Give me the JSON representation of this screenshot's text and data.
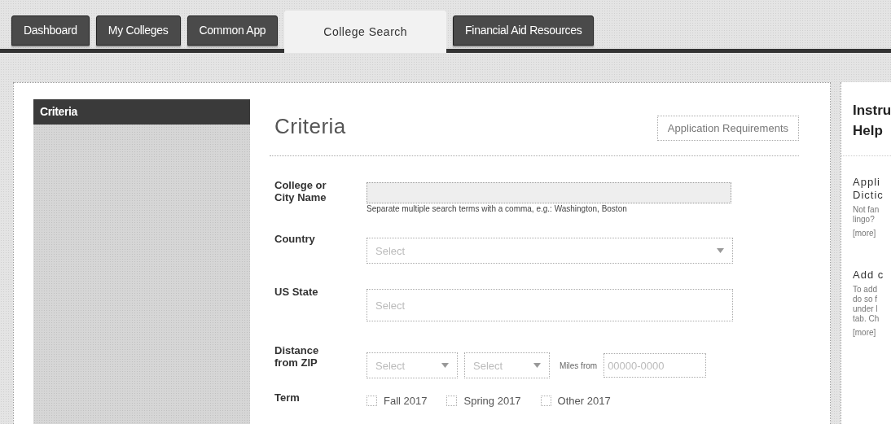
{
  "tabs": [
    {
      "label": "Dashboard",
      "selected": false
    },
    {
      "label": "My Colleges",
      "selected": false
    },
    {
      "label": "Common App",
      "selected": false
    },
    {
      "label": "College Search",
      "selected": true
    },
    {
      "label": "Financial Aid Resources",
      "selected": false
    }
  ],
  "sidebar": {
    "items": [
      {
        "label": "Criteria",
        "selected": true
      }
    ]
  },
  "form": {
    "title": "Criteria",
    "action": "Application Requirements",
    "fields": [
      {
        "kind": "text",
        "label": [
          "College or",
          "City Name"
        ],
        "hint": "Separate multiple search terms with a comma, e.g.: Washington, Boston"
      },
      {
        "kind": "dropdown",
        "label": [
          "Country"
        ],
        "placeholder": "Select"
      },
      {
        "kind": "select",
        "label": [
          "US State"
        ],
        "placeholder": "Select"
      },
      {
        "kind": "distance",
        "label": [
          "Distance",
          "from ZIP"
        ],
        "selects": [
          {
            "placeholder": "Select"
          },
          {
            "placeholder": "Select"
          }
        ],
        "miles_label": "Miles from",
        "zip_placeholder": "00000-0000"
      },
      {
        "kind": "checks",
        "label": [
          "Term"
        ],
        "options": [
          {
            "label": "Fall 2017",
            "checked": false
          },
          {
            "label": "Spring 2017",
            "checked": false
          },
          {
            "label": "Other 2017",
            "checked": false
          }
        ]
      }
    ]
  },
  "help_panel": {
    "title": [
      "Instru",
      "Help"
    ],
    "sections": [
      {
        "heading": [
          "Appli",
          "Dictic"
        ],
        "body": [
          "Not fan",
          "lingo?"
        ],
        "link": "[more]"
      },
      {
        "heading": [
          "Add c"
        ],
        "body": [
          "To add",
          "do so f",
          "under l",
          "tab. Ch"
        ],
        "link": "[more]"
      }
    ]
  }
}
